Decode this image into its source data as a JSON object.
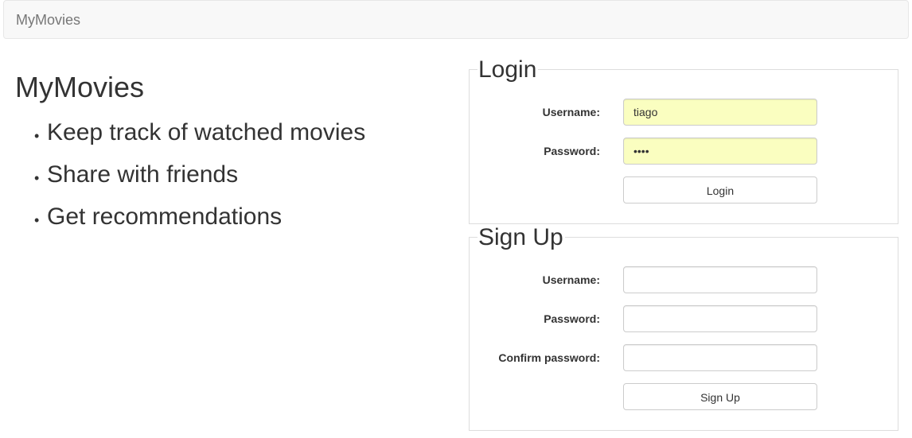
{
  "navbar": {
    "brand": "MyMovies"
  },
  "hero": {
    "title": "MyMovies",
    "features": [
      "Keep track of watched movies",
      "Share with friends",
      "Get recommendations"
    ]
  },
  "login": {
    "legend": "Login",
    "username_label": "Username:",
    "username_value": "tiago",
    "password_label": "Password:",
    "password_value": "tiag",
    "button_label": "Login"
  },
  "signup": {
    "legend": "Sign Up",
    "username_label": "Username:",
    "username_value": "",
    "password_label": "Password:",
    "password_value": "",
    "confirm_label": "Confirm password:",
    "confirm_value": "",
    "button_label": "Sign Up"
  },
  "colors": {
    "autofill_background": "#fafec0",
    "navbar_background": "#f8f8f8",
    "brand_text": "#777777"
  }
}
